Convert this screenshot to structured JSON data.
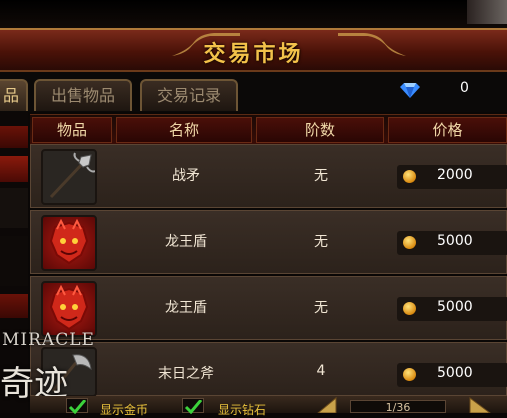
{
  "window": {
    "title": "交易市场"
  },
  "tabs": [
    {
      "label": "品",
      "active": true
    },
    {
      "label": "出售物品",
      "active": false
    },
    {
      "label": "交易记录",
      "active": false
    }
  ],
  "currency": {
    "icon": "diamond-icon",
    "count": "0"
  },
  "table": {
    "columns": [
      "物品",
      "名称",
      "阶数",
      "价格"
    ],
    "rows": [
      {
        "icon": "spear-icon",
        "name": "战矛",
        "tier": "无",
        "price": "2000"
      },
      {
        "icon": "dragon-shield-icon",
        "name": "龙王盾",
        "tier": "无",
        "price": "5000"
      },
      {
        "icon": "dragon-shield-icon",
        "name": "龙王盾",
        "tier": "无",
        "price": "5000"
      },
      {
        "icon": "axe-icon",
        "name": "末日之斧",
        "tier": "4",
        "price": "5000"
      }
    ]
  },
  "footer": {
    "show_gold": "显示金币",
    "show_diamond": "显示钻石",
    "page": "1/36"
  },
  "watermark": {
    "line1": "MIRACLE",
    "line2": "奇迹"
  },
  "colors": {
    "title": "#f3c24a",
    "footer_text": "#e9c23c",
    "cell_text": "#f1e6d4"
  }
}
